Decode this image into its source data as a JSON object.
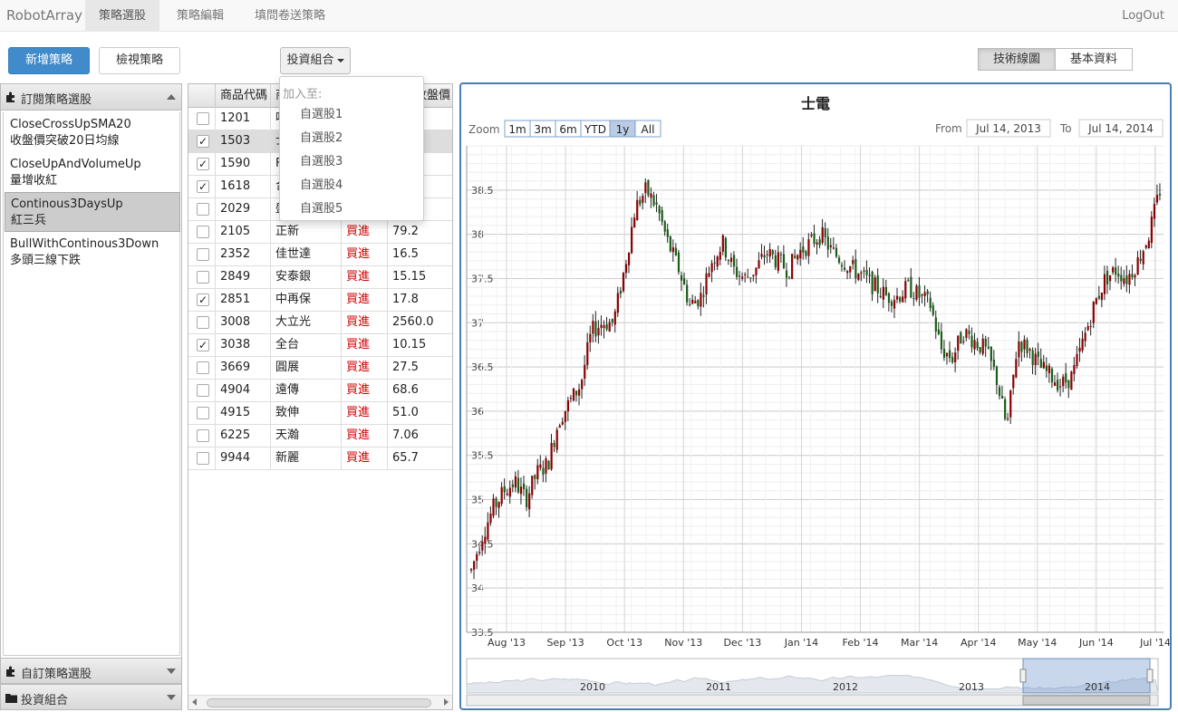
{
  "navbar": {
    "brand": "RobotArray",
    "links": [
      "策略選股",
      "策略編輯",
      "填問卷送策略"
    ],
    "logout": "LogOut"
  },
  "toolbar": {
    "new_strategy": "新增策略",
    "view_strategy": "檢視策略",
    "portfolio": "投資組合",
    "tab_technical": "技術線圖",
    "tab_basic": "基本資料"
  },
  "sidebar": {
    "sections": [
      "訂閱策略選股",
      "自訂策略選股",
      "投資組合"
    ],
    "strategies": [
      {
        "name": "CloseCrossUpSMA20",
        "desc": "收盤價突破20日均線"
      },
      {
        "name": "CloseUpAndVolumeUp",
        "desc": "量增收紅"
      },
      {
        "name": "Continous3DaysUp",
        "desc": "紅三兵"
      },
      {
        "name": "BullWithContinous3Down",
        "desc": "多頭三線下跌"
      }
    ]
  },
  "dropdown": {
    "header": "加入至:",
    "items": [
      "自選股1",
      "自選股2",
      "自選股3",
      "自選股4",
      "自選股5"
    ]
  },
  "table": {
    "headers": [
      "商品代碼",
      "商",
      "收盤價"
    ],
    "rows": [
      {
        "checked": false,
        "code": "1201",
        "name": "味",
        "signal": "",
        "price": ""
      },
      {
        "checked": true,
        "code": "1503",
        "name": "士",
        "signal": "",
        "price": ""
      },
      {
        "checked": true,
        "code": "1590",
        "name": "F",
        "signal": "",
        "price": ""
      },
      {
        "checked": true,
        "code": "1618",
        "name": "合",
        "signal": "",
        "price": ""
      },
      {
        "checked": false,
        "code": "2029",
        "name": "盛",
        "signal": "",
        "price": ""
      },
      {
        "checked": false,
        "code": "2105",
        "name": "正新",
        "signal": "買進",
        "price": "79.2"
      },
      {
        "checked": false,
        "code": "2352",
        "name": "佳世達",
        "signal": "買進",
        "price": "16.5"
      },
      {
        "checked": false,
        "code": "2849",
        "name": "安泰銀",
        "signal": "買進",
        "price": "15.15"
      },
      {
        "checked": true,
        "code": "2851",
        "name": "中再保",
        "signal": "買進",
        "price": "17.8"
      },
      {
        "checked": false,
        "code": "3008",
        "name": "大立光",
        "signal": "買進",
        "price": "2560.0"
      },
      {
        "checked": true,
        "code": "3038",
        "name": "全台",
        "signal": "買進",
        "price": "10.15"
      },
      {
        "checked": false,
        "code": "3669",
        "name": "圓展",
        "signal": "買進",
        "price": "27.5"
      },
      {
        "checked": false,
        "code": "4904",
        "name": "遠傳",
        "signal": "買進",
        "price": "68.6"
      },
      {
        "checked": false,
        "code": "4915",
        "name": "致伸",
        "signal": "買進",
        "price": "51.0"
      },
      {
        "checked": false,
        "code": "6225",
        "name": "天瀚",
        "signal": "買進",
        "price": "7.06"
      },
      {
        "checked": false,
        "code": "9944",
        "name": "新麗",
        "signal": "買進",
        "price": "65.7"
      }
    ]
  },
  "chart": {
    "zoom_label": "Zoom",
    "zoom_buttons": [
      "1m",
      "3m",
      "6m",
      "YTD",
      "1y",
      "All"
    ],
    "from_label": "From",
    "from_value": "Jul 14, 2013",
    "to_label": "To",
    "to_value": "Jul 14, 2014",
    "navigator_years": [
      "2010",
      "2011",
      "2012",
      "2013",
      "2014"
    ]
  },
  "chart_data": {
    "type": "candlestick",
    "title": "士電",
    "x_ticks": [
      "Aug '13",
      "Sep '13",
      "Oct '13",
      "Nov '13",
      "Dec '13",
      "Jan '14",
      "Feb '14",
      "Mar '14",
      "Apr '14",
      "May '14",
      "Jun '14",
      "Jul '14"
    ],
    "y_ticks": [
      33.5,
      34,
      34.5,
      35,
      35.5,
      36,
      36.5,
      37,
      37.5,
      38,
      38.5
    ],
    "ylim": [
      33.5,
      39.0
    ],
    "up_color": "#8b0000",
    "down_color": "#1a5e1a",
    "trend": [
      34.2,
      34.6,
      34.9,
      35.1,
      35.2,
      35.0,
      35.3,
      35.4,
      35.9,
      36.1,
      36.3,
      36.9,
      37.0,
      37.0,
      37.6,
      38.3,
      38.5,
      38.3,
      37.9,
      37.6,
      37.2,
      37.3,
      37.7,
      37.9,
      37.6,
      37.5,
      37.6,
      37.8,
      37.7,
      37.6,
      37.8,
      37.9,
      38.0,
      37.8,
      37.7,
      37.6,
      37.5,
      37.4,
      37.3,
      37.3,
      37.4,
      37.3,
      37.2,
      36.7,
      36.6,
      36.9,
      36.8,
      36.7,
      36.4,
      35.8,
      36.8,
      36.7,
      36.5,
      36.4,
      36.3,
      36.4,
      36.8,
      37.2,
      37.5,
      37.6,
      37.5,
      37.7,
      38.0,
      38.5
    ]
  }
}
